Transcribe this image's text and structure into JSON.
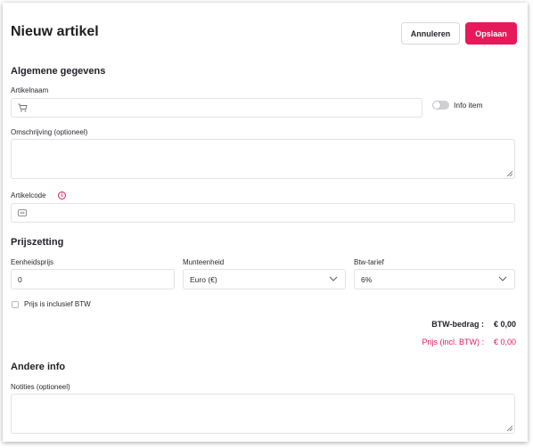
{
  "header": {
    "title": "Nieuw artikel",
    "cancel_label": "Annuleren",
    "save_label": "Opslaan"
  },
  "general": {
    "section_title": "Algemene gegevens",
    "name_label": "Artikelnaam",
    "name_value": "",
    "name_icon": "cart-icon",
    "info_item_label": "Info item",
    "info_item_on": false,
    "description_label": "Omschrijving (optioneel)",
    "description_value": "",
    "code_label": "Artikelcode",
    "code_value": "",
    "code_icon": "barcode-icon",
    "code_info_glyph": "i"
  },
  "pricing": {
    "section_title": "Prijszetting",
    "unit_price_label": "Eenheidsprijs",
    "unit_price_value": "0",
    "currency_label": "Munteenheid",
    "currency_value": "Euro (€)",
    "vat_rate_label": "Btw-tarief",
    "vat_rate_value": "6%",
    "incl_vat_label": "Prijs is inclusief BTW",
    "incl_vat_checked": false,
    "vat_amount_label": "BTW-bedrag :",
    "vat_amount_value": "€ 0,00",
    "total_label": "Prijs (incl. BTW) :",
    "total_value": "€ 0,00"
  },
  "other": {
    "section_title": "Andere info",
    "notes_label": "Notities (optioneel)",
    "notes_value": ""
  },
  "colors": {
    "accent": "#e6195a",
    "border": "#e3e3e7",
    "text": "#1f1f24"
  }
}
